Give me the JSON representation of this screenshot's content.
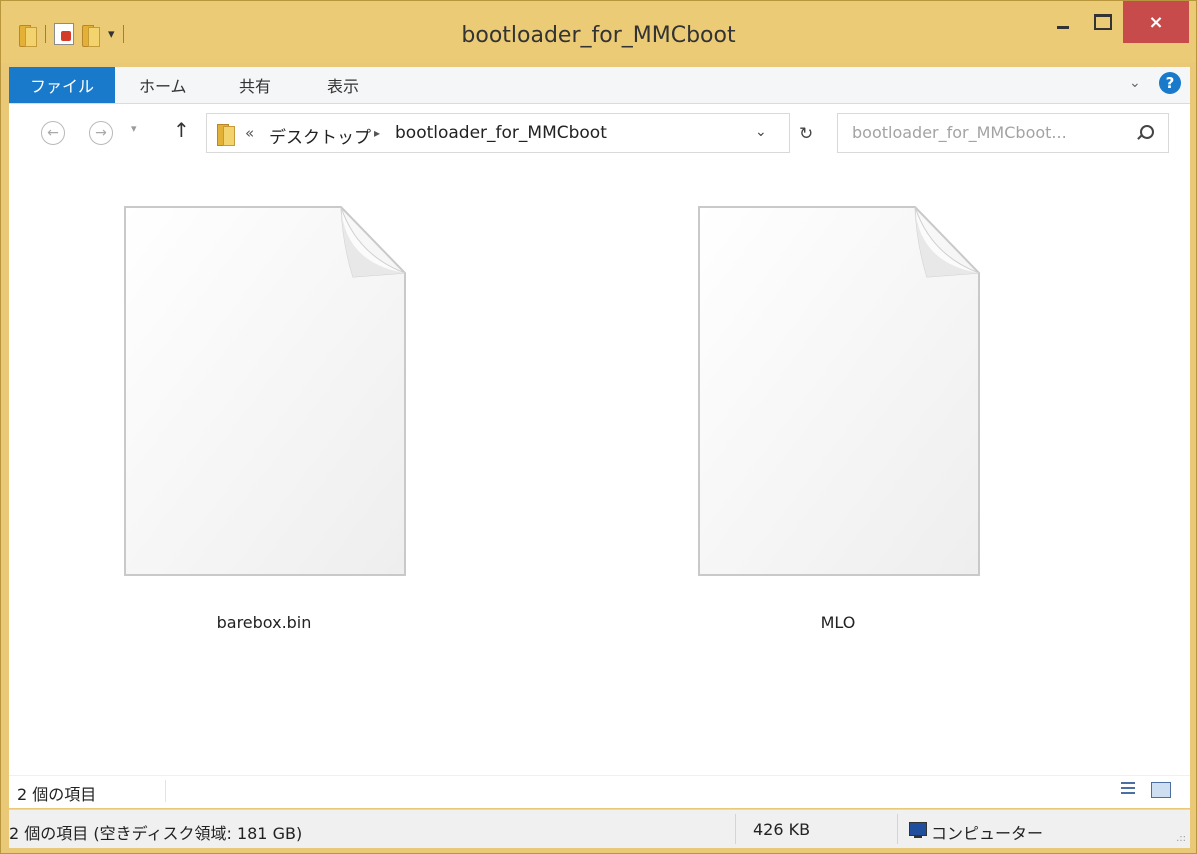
{
  "window": {
    "title": "bootloader_for_MMCboot",
    "close_glyph": "×"
  },
  "quick_access": {
    "dropdown_glyph": "▾"
  },
  "ribbon": {
    "file_tab": "ファイル",
    "tabs": [
      "ホーム",
      "共有",
      "表示"
    ],
    "expand_glyph": "⌄",
    "help_glyph": "?"
  },
  "navigation": {
    "back_glyph": "←",
    "forward_glyph": "→",
    "history_glyph": "▾",
    "up_glyph": "↑",
    "breadcrumb_more": "«",
    "breadcrumb": [
      "デスクトップ",
      "bootloader_for_MMCboot"
    ],
    "breadcrumb_arrow": "▸",
    "address_dropdown_glyph": "⌄",
    "refresh_glyph": "↻",
    "search_placeholder": "bootloader_for_MMCboot..."
  },
  "files": [
    {
      "name": "barebox.bin",
      "icon": "blank-document-icon"
    },
    {
      "name": "MLO",
      "icon": "blank-document-icon"
    }
  ],
  "details_bar": {
    "item_count": "2 個の項目"
  },
  "status_bar": {
    "summary": "2 個の項目 (空きディスク領域: 181 GB)",
    "size": "426 KB",
    "location": "コンピューター",
    "grip_glyph": ".::"
  },
  "colors": {
    "title_bar": "#eccb77",
    "file_tab": "#1979ca",
    "close_button": "#c74b4b"
  }
}
